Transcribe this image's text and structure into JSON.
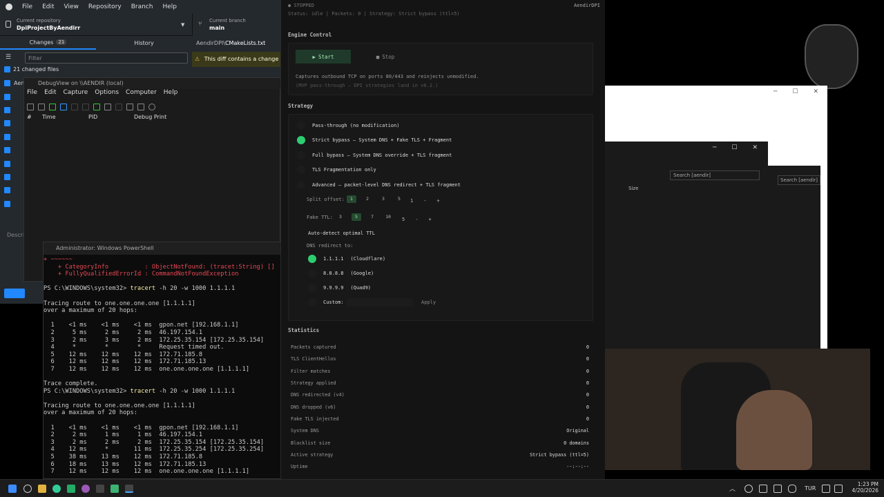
{
  "github": {
    "menu": [
      "File",
      "Edit",
      "View",
      "Repository",
      "Branch",
      "Help"
    ],
    "repo_label": "Current repository",
    "repo_name": "DpiProjectByAendirr",
    "branch_label": "Current branch",
    "branch_name": "main",
    "tab_changes": "Changes",
    "changes_count": "21",
    "tab_history": "History",
    "filter_placeholder": "Filter",
    "changed_files": "21 changed files",
    "diff_path": "AendirDPI\\",
    "diff_file": "CMakeLists.txt",
    "warn_text": "This diff contains a change",
    "file_prefix": "Aen",
    "desc_label": "Descri"
  },
  "debugview": {
    "title": "DebugView on \\\\AENDIR (local)",
    "menu": [
      "File",
      "Edit",
      "Capture",
      "Options",
      "Computer",
      "Help"
    ],
    "cols": [
      "#",
      "Time",
      "PID",
      "Debug Print"
    ]
  },
  "powershell": {
    "title": "Administrator: Windows PowerShell",
    "lines": [
      {
        "t": "+ ~~~~~~",
        "c": "err"
      },
      {
        "t": "    + CategoryInfo          : ObjectNotFound: (tracet:String) []",
        "c": "err"
      },
      {
        "t": "    + FullyQualifiedErrorId : CommandNotFoundException",
        "c": "err"
      },
      {
        "t": "",
        "c": ""
      },
      {
        "t": "PS C:\\WINDOWS\\system32> tracert -h 20 -w 1000 1.1.1.1",
        "c": ""
      },
      {
        "t": "",
        "c": ""
      },
      {
        "t": "Tracing route to one.one.one.one [1.1.1.1]",
        "c": ""
      },
      {
        "t": "over a maximum of 20 hops:",
        "c": ""
      },
      {
        "t": "",
        "c": ""
      },
      {
        "t": "  1    <1 ms    <1 ms    <1 ms  gpon.net [192.168.1.1]",
        "c": ""
      },
      {
        "t": "  2     5 ms     2 ms     2 ms  46.197.154.1",
        "c": ""
      },
      {
        "t": "  3     2 ms     3 ms     2 ms  172.25.35.154 [172.25.35.154]",
        "c": ""
      },
      {
        "t": "  4     *        *        *     Request timed out.",
        "c": ""
      },
      {
        "t": "  5    12 ms    12 ms    12 ms  172.71.185.8",
        "c": ""
      },
      {
        "t": "  6    12 ms    12 ms    12 ms  172.71.185.13",
        "c": ""
      },
      {
        "t": "  7    12 ms    12 ms    12 ms  one.one.one.one [1.1.1.1]",
        "c": ""
      },
      {
        "t": "",
        "c": ""
      },
      {
        "t": "Trace complete.",
        "c": ""
      },
      {
        "t": "PS C:\\WINDOWS\\system32> tracert -h 20 -w 1000 1.1.1.1",
        "c": ""
      },
      {
        "t": "",
        "c": ""
      },
      {
        "t": "Tracing route to one.one.one.one [1.1.1.1]",
        "c": ""
      },
      {
        "t": "over a maximum of 20 hops:",
        "c": ""
      },
      {
        "t": "",
        "c": ""
      },
      {
        "t": "  1    <1 ms    <1 ms    <1 ms  gpon.net [192.168.1.1]",
        "c": ""
      },
      {
        "t": "  2     2 ms     1 ms     1 ms  46.197.154.1",
        "c": ""
      },
      {
        "t": "  3     2 ms     2 ms     2 ms  172.25.35.154 [172.25.35.154]",
        "c": ""
      },
      {
        "t": "  4    12 ms     *       11 ms  172.25.35.254 [172.25.35.254]",
        "c": ""
      },
      {
        "t": "  5    38 ms    13 ms    12 ms  172.71.185.8",
        "c": ""
      },
      {
        "t": "  6    18 ms    13 ms    12 ms  172.71.185.13",
        "c": ""
      },
      {
        "t": "  7    12 ms    12 ms    12 ms  one.one.one.one [1.1.1.1]",
        "c": ""
      }
    ]
  },
  "aendir": {
    "state": "STOPPED",
    "brand": "AendirDPI",
    "status_line": "Status: idle  |  Packets: 0  |  Strategy: Strict bypass (ttl=5)",
    "engine_title": "Engine Control",
    "start_label": "Start",
    "stop_label": "Stop",
    "engine_desc": "Captures outbound TCP on ports 80/443 and reinjects unmodified.",
    "engine_note": "(MVP pass-through — DPI strategies land in v0.2.)",
    "strategy_title": "Strategy",
    "strategies": [
      {
        "label": "Pass-through (no modification)",
        "on": false
      },
      {
        "label": "Strict bypass  — System DNS + Fake TLS + Fragment",
        "on": true
      },
      {
        "label": "Full bypass  — System DNS override + TLS fragment",
        "on": false
      },
      {
        "label": "TLS Fragmentation only",
        "on": false
      },
      {
        "label": "Advanced  — packet-level DNS redirect + TLS fragment",
        "on": false
      }
    ],
    "split_label": "Split offset:",
    "split_opts": [
      "1",
      "2",
      "3",
      "5"
    ],
    "split_selected": "1",
    "split_value": "1",
    "ttl_label": "Fake TTL:",
    "ttl_opts": [
      "3",
      "5",
      "7",
      "10"
    ],
    "ttl_selected": "5",
    "ttl_value": "5",
    "minus": "-",
    "plus": "+",
    "autodetect": "Auto-detect optimal TTL",
    "dns_label": "DNS redirect to:",
    "dns_opts": [
      {
        "ip": "1.1.1.1",
        "name": "(Cloudflare)",
        "on": true
      },
      {
        "ip": "8.8.8.8",
        "name": "(Google)",
        "on": false
      },
      {
        "ip": "9.9.9.9",
        "name": "(Quad9)",
        "on": false
      }
    ],
    "custom_label": "Custom:",
    "apply_label": "Apply",
    "stats_title": "Statistics",
    "stats": [
      {
        "k": "Packets captured",
        "v": "0"
      },
      {
        "k": "TLS ClientHellos",
        "v": "0"
      },
      {
        "k": "Filter matches",
        "v": "0"
      },
      {
        "k": "Strategy applied",
        "v": "0"
      },
      {
        "k": "DNS redirected (v4)",
        "v": "0"
      },
      {
        "k": "DNS dropped (v6)",
        "v": "0"
      },
      {
        "k": "Fake TLS injected",
        "v": "0"
      },
      {
        "k": "System DNS",
        "v": "Original"
      },
      {
        "k": "Blacklist size",
        "v": "0 domains"
      },
      {
        "k": "Active strategy",
        "v": "Strict bypass (ttl=5)"
      },
      {
        "k": "Uptime",
        "v": "--:--:--"
      }
    ]
  },
  "right": {
    "search1": "Search [aendir]",
    "search2": "Search [aendir]",
    "size_col": "Size"
  },
  "taskbar": {
    "lang": "TUR",
    "time": "1:23 PM",
    "date": "4/20/2026"
  }
}
